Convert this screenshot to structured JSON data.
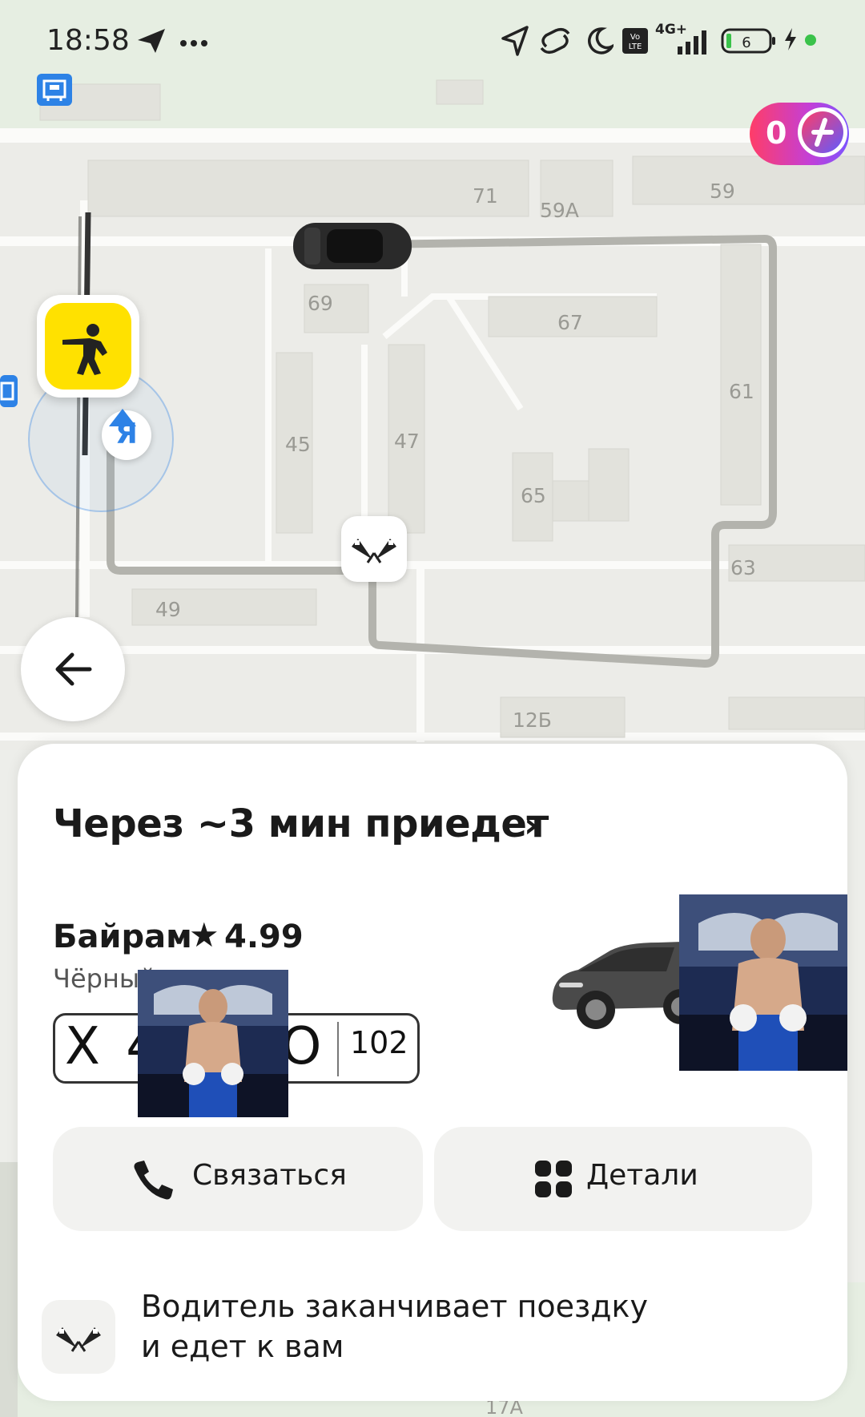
{
  "status_bar": {
    "time": "18:58",
    "icons": [
      "telegram-icon",
      "more-dots-icon",
      "location-arrow-icon",
      "hotspot-icon",
      "moon-icon",
      "volte-icon",
      "signal-4g-icon",
      "battery-icon",
      "charging-icon",
      "green-dot-icon"
    ],
    "network": "4G+",
    "volte": "Vo LTE",
    "battery_level": "6"
  },
  "map": {
    "building_labels": [
      "71",
      "59А",
      "59",
      "69",
      "67",
      "61",
      "45",
      "47",
      "65",
      "63",
      "49",
      "12Б",
      "17А"
    ],
    "user_marker": "Я",
    "transit_icon": "bus-stop-icon"
  },
  "plus_badge": {
    "count": "0",
    "icon": "plus-icon"
  },
  "trip": {
    "eta_title": "Через ~3 мин приедет",
    "chevron": "›",
    "driver_name": "Байрам",
    "star": "★",
    "rating": "4.99",
    "car_description": "Чёрный",
    "plate_main": "Х 4",
    "plate_tail": "О",
    "plate_region": "102"
  },
  "actions": {
    "contact_label": "Связаться",
    "details_label": "Детали"
  },
  "status_note": {
    "line1": "Водитель заканчивает поездку",
    "line2": "и едет к вам"
  },
  "colors": {
    "accent_yellow": "#ffe100",
    "yandex_blue": "#2d82e6",
    "sheet_bg": "#ffffff",
    "button_bg": "#f2f2f0",
    "plus_gradient_start": "#ff3d68",
    "plus_gradient_end": "#7b54ff"
  }
}
